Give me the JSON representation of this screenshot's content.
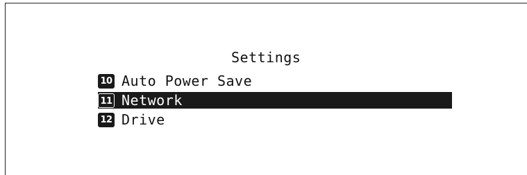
{
  "screen": {
    "title": "Settings",
    "menu": [
      {
        "number": "10",
        "label": "Auto Power Save",
        "selected": false
      },
      {
        "number": "11",
        "label": "Network",
        "selected": true
      },
      {
        "number": "12",
        "label": "Drive",
        "selected": false
      }
    ]
  }
}
